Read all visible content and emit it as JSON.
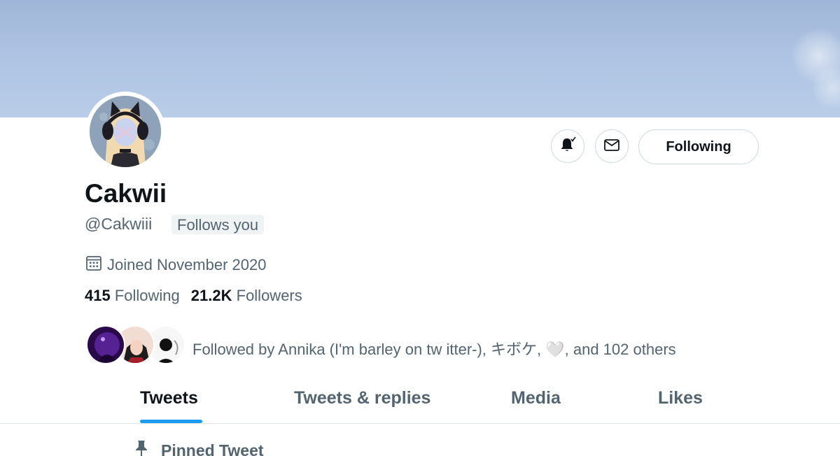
{
  "profile": {
    "display_name": "Cakwii",
    "handle": "@Cakwiii",
    "follows_you_badge": "Follows you",
    "joined": "Joined November 2020",
    "following_count": "415",
    "following_label": "Following",
    "followers_count": "21.2K",
    "followers_label": "Followers",
    "followed_by_text": "Followed by Annika (I'm barley on tw itter-), キボケ, 🤍, and 102 others"
  },
  "actions": {
    "notify_icon": "bell-check-icon",
    "message_icon": "mail-icon",
    "follow_button_label": "Following"
  },
  "tabs": [
    {
      "label": "Tweets",
      "active": true
    },
    {
      "label": "Tweets & replies",
      "active": false
    },
    {
      "label": "Media",
      "active": false
    },
    {
      "label": "Likes",
      "active": false
    }
  ],
  "pinned": {
    "label": "Pinned Tweet",
    "icon": "pin-icon"
  },
  "colors": {
    "accent": "#1d9bf0",
    "text_primary": "#0f1419",
    "text_secondary": "#536471",
    "banner": "#aec3e2"
  }
}
